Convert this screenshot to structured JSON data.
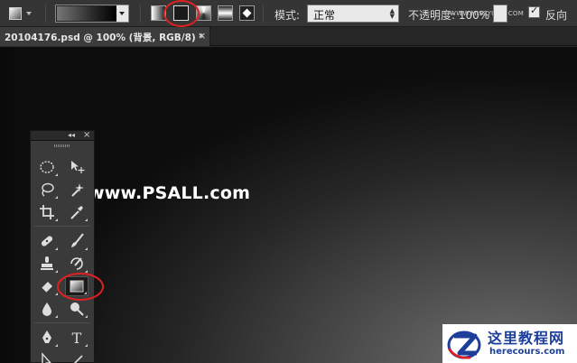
{
  "options_bar": {
    "mode_label": "模式:",
    "mode_value": "正常",
    "opacity_label": "不透明度: 100%",
    "watermark_text": "WWW.MISSYUAN.COM",
    "reverse_label": "反向",
    "reverse_checked": true
  },
  "document_tab": {
    "label": "20104176.psd @ 100% (背景, RGB/8) *",
    "close": "×"
  },
  "toolbox": {
    "collapse": "◂◂",
    "close": "×",
    "text_tool_glyph": "T"
  },
  "watermark": "www.PSALL.com",
  "logo": {
    "title": "这里教程网",
    "url": "herecours.com"
  },
  "colors": {
    "annotation": "#e02020",
    "logo_blue": "#1d3f9a"
  }
}
